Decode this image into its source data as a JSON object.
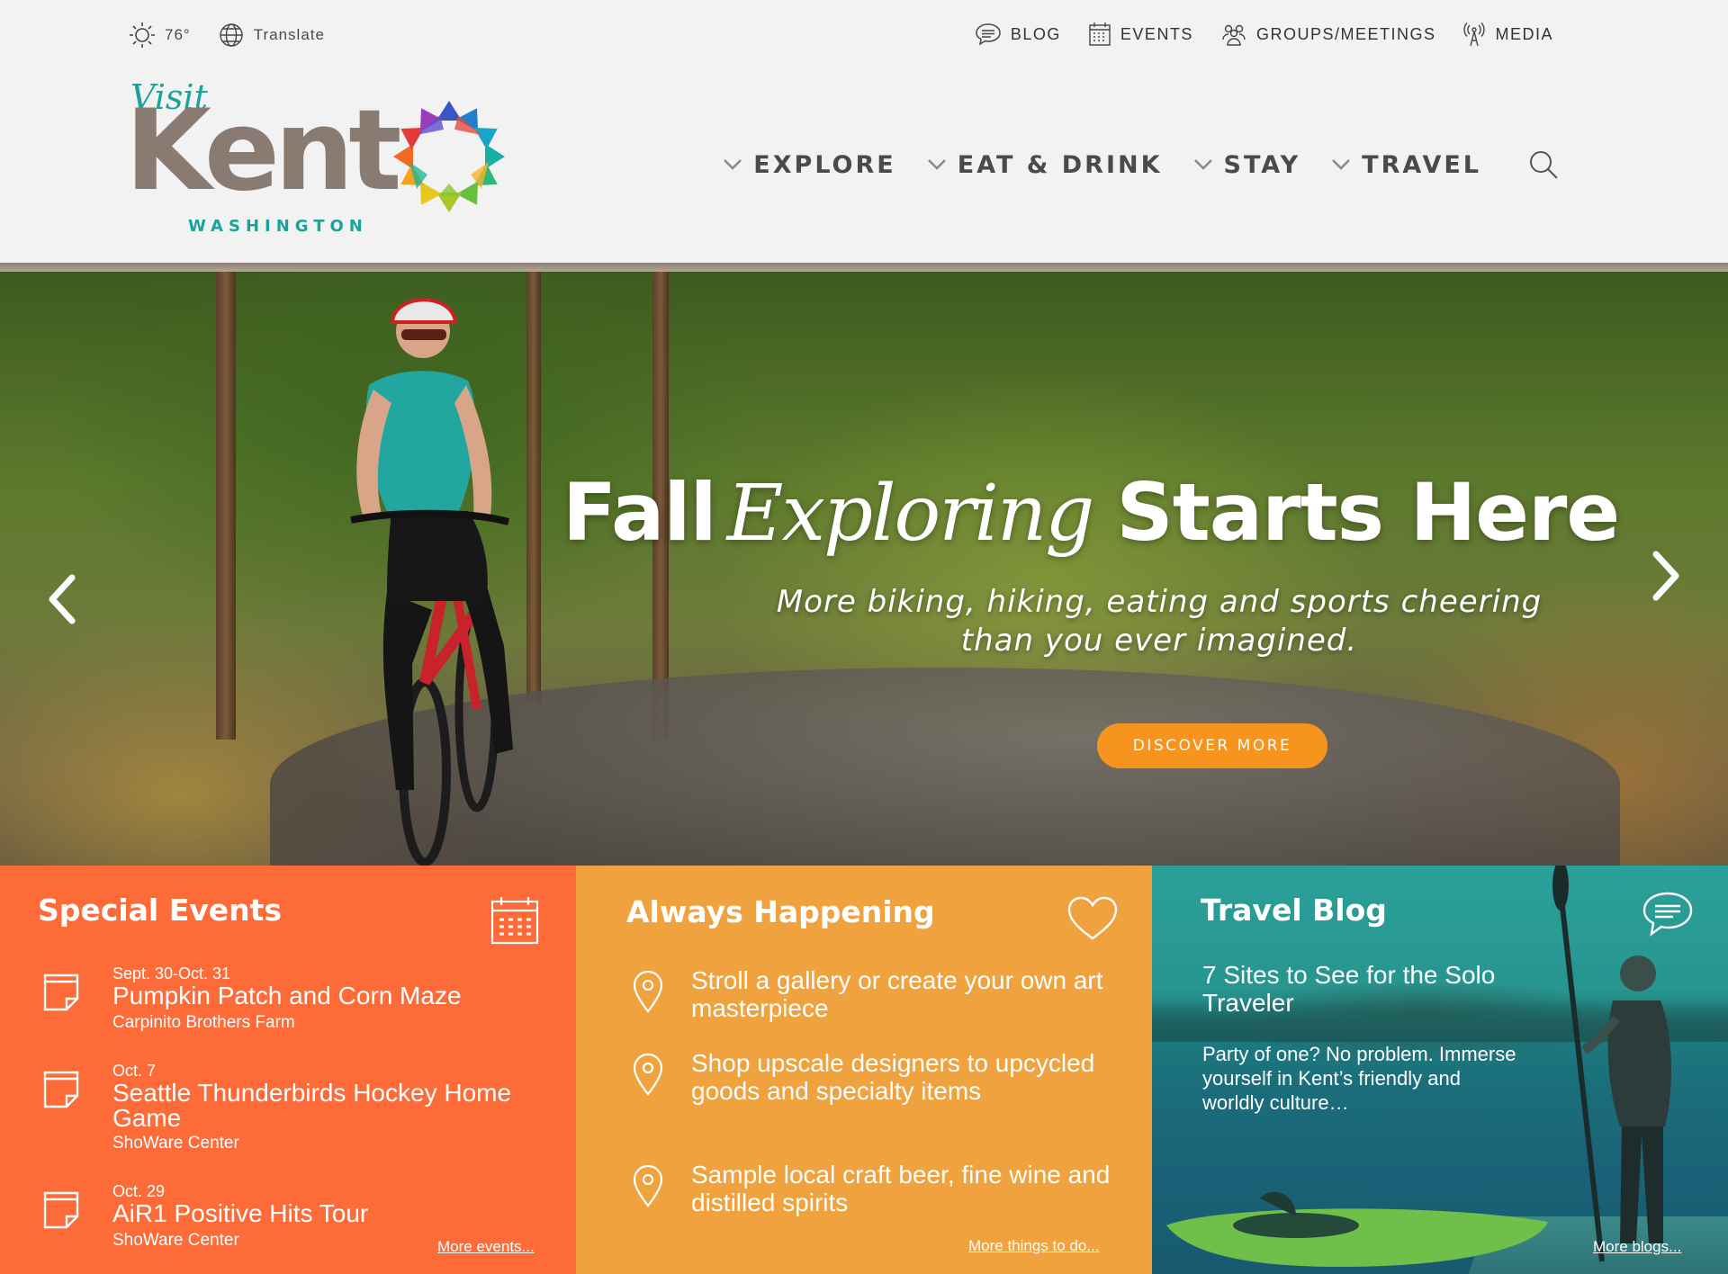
{
  "utility": {
    "weather": "76°",
    "translate": "Translate",
    "links": [
      "BLOG",
      "EVENTS",
      "GROUPS/MEETINGS",
      "MEDIA"
    ]
  },
  "logo": {
    "visit": "Visit",
    "kent": "Kent",
    "washington": "WASHINGTON"
  },
  "nav": [
    "EXPLORE",
    "EAT & DRINK",
    "STAY",
    "TRAVEL"
  ],
  "hero": {
    "heading_part1": "Fall",
    "heading_script": "Exploring",
    "heading_part2": "Starts Here",
    "subheading": "More biking, hiking, eating and sports cheering than you ever imagined.",
    "cta": "DISCOVER MORE"
  },
  "special_events": {
    "title": "Special Events",
    "items": [
      {
        "date": "Sept. 30-Oct. 31",
        "name": "Pumpkin Patch and Corn Maze",
        "venue": "Carpinito Brothers Farm"
      },
      {
        "date": "Oct. 7",
        "name": "Seattle Thunderbirds Hockey Home Game",
        "venue": "ShoWare Center"
      },
      {
        "date": "Oct. 29",
        "name": "AiR1 Positive Hits Tour",
        "venue": "ShoWare Center"
      }
    ],
    "more": "More events..."
  },
  "always_happening": {
    "title": "Always Happening",
    "items": [
      "Stroll a gallery or create your own art masterpiece",
      "Shop upscale designers to upcycled goods and specialty items",
      "Sample local craft beer, fine wine and distilled spirits"
    ],
    "more": "More things to do..."
  },
  "travel_blog": {
    "title": "Travel Blog",
    "post_title": "7 Sites to See for the Solo Traveler",
    "excerpt": "Party of one? No problem. Immerse yourself in Kent’s friendly and worldly culture…",
    "more": "More blogs..."
  },
  "colors": {
    "events": "#fd6b39",
    "always": "#f0a23e",
    "blog": "#1f8f8c",
    "cta": "#f7941d",
    "brand_teal": "#1aa39a",
    "brand_taupe": "#8a7b72"
  },
  "icons": {
    "weather": "sun-icon",
    "translate": "globe-icon",
    "blog": "speech-bubble-icon",
    "events": "calendar-icon",
    "groups": "people-icon",
    "media": "broadcast-tower-icon",
    "search": "search-icon",
    "events_panel": "calendar-icon",
    "always_panel": "heart-icon",
    "blog_panel": "chat-bubble-icon",
    "event_item": "document-icon",
    "happen_item": "location-pin-icon"
  }
}
